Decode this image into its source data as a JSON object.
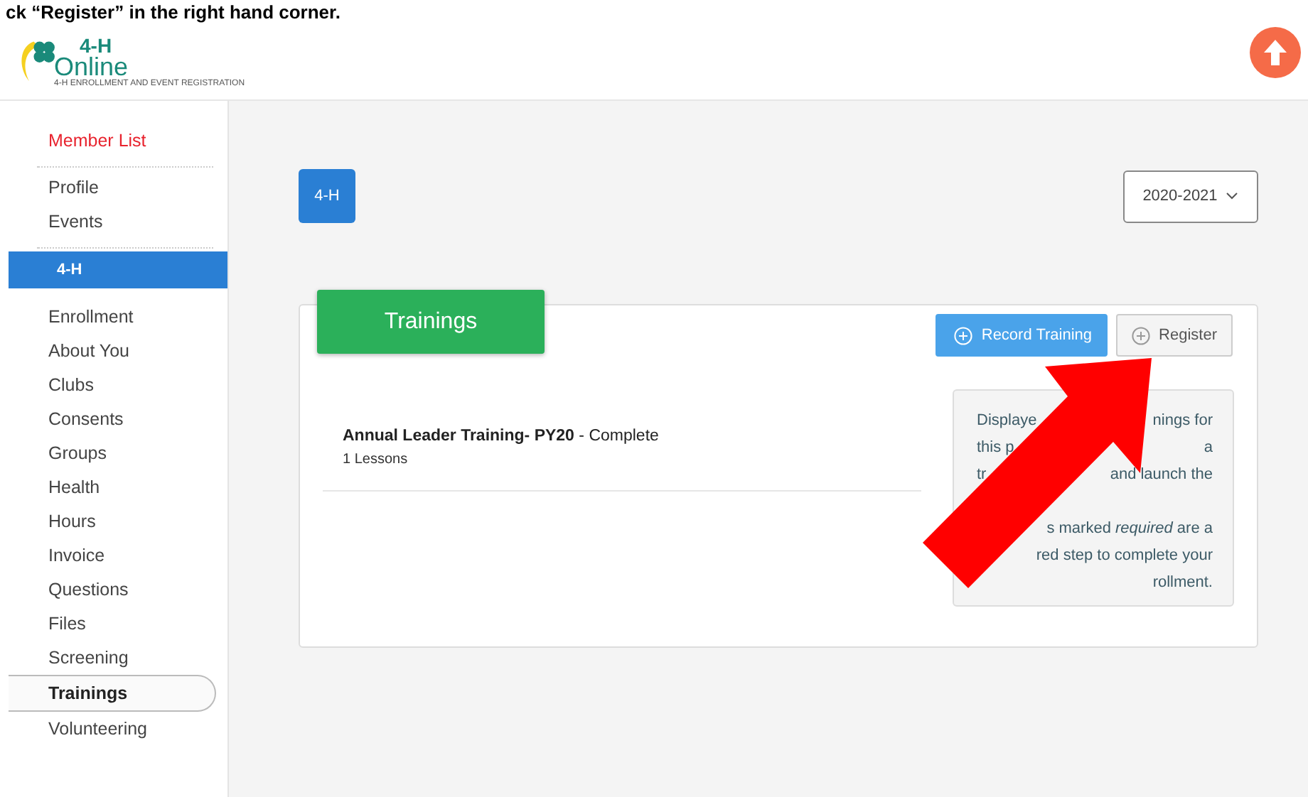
{
  "caption": "ck “Register” in the right hand corner.",
  "logo": {
    "line_1": "4-H",
    "line_2": "Online",
    "tagline": "4-H ENROLLMENT AND EVENT REGISTRATION"
  },
  "sidebar": {
    "groups": [
      {
        "items": [
          {
            "label": "Member List",
            "kind": "link",
            "selected": false
          }
        ]
      },
      {
        "items": [
          {
            "label": "Profile",
            "kind": "item",
            "selected": false
          },
          {
            "label": "Events",
            "kind": "item",
            "selected": false
          }
        ]
      },
      {
        "items": [
          {
            "label": "4-H",
            "kind": "section",
            "selected": false
          },
          {
            "label": "Enrollment",
            "kind": "item",
            "selected": false
          },
          {
            "label": "About You",
            "kind": "item",
            "selected": false
          },
          {
            "label": "Clubs",
            "kind": "item",
            "selected": false
          },
          {
            "label": "Consents",
            "kind": "item",
            "selected": false
          },
          {
            "label": "Groups",
            "kind": "item",
            "selected": false
          },
          {
            "label": "Health",
            "kind": "item",
            "selected": false
          },
          {
            "label": "Hours",
            "kind": "item",
            "selected": false
          },
          {
            "label": "Invoice",
            "kind": "item",
            "selected": false
          },
          {
            "label": "Questions",
            "kind": "item",
            "selected": false
          },
          {
            "label": "Files",
            "kind": "item",
            "selected": false
          },
          {
            "label": "Screening",
            "kind": "item",
            "selected": false
          },
          {
            "label": "Trainings",
            "kind": "item",
            "selected": true
          },
          {
            "label": "Volunteering",
            "kind": "item",
            "selected": false
          }
        ]
      }
    ]
  },
  "program_button": "4-H",
  "year_select": {
    "value": "2020-2021"
  },
  "trainings": {
    "title": "Trainings",
    "buttons": [
      {
        "label": "Record Training",
        "kind": "primary"
      },
      {
        "label": "Register",
        "kind": "secondary"
      }
    ],
    "rows": [
      {
        "title": "**Annual Leader Training- PY20** - Complete",
        "lessons": "1 Lessons"
      }
    ],
    "info_paragraphs": [
      {
        "lines": [
          {
            "left": "Displaye",
            "right": "nings for"
          },
          {
            "left": "this p",
            "right": "a"
          },
          {
            "left": "tr",
            "right": "and launch the"
          }
        ]
      },
      {
        "lines": [
          {
            "right": "s marked *required* are a"
          },
          {
            "right": "red step to complete your"
          },
          {
            "right": "rollment."
          }
        ]
      }
    ]
  }
}
